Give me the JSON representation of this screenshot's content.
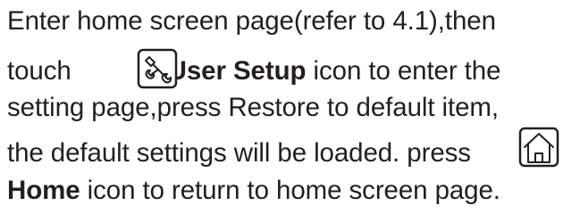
{
  "paragraph": {
    "line1": "Enter home screen page(refer to 4.1),then",
    "line2_before_icon": "touch",
    "line2_bold": "User Setup",
    "line2_after": "icon to enter the",
    "line3": "setting page,press Restore to default item,",
    "line4_before_icon": "the default settings will be loaded. press",
    "line5_bold": "Home",
    "line5_after": "icon to return to home screen page."
  },
  "icons": {
    "setup_icon": "wrench-screwdriver-icon",
    "home_icon": "home-icon"
  }
}
